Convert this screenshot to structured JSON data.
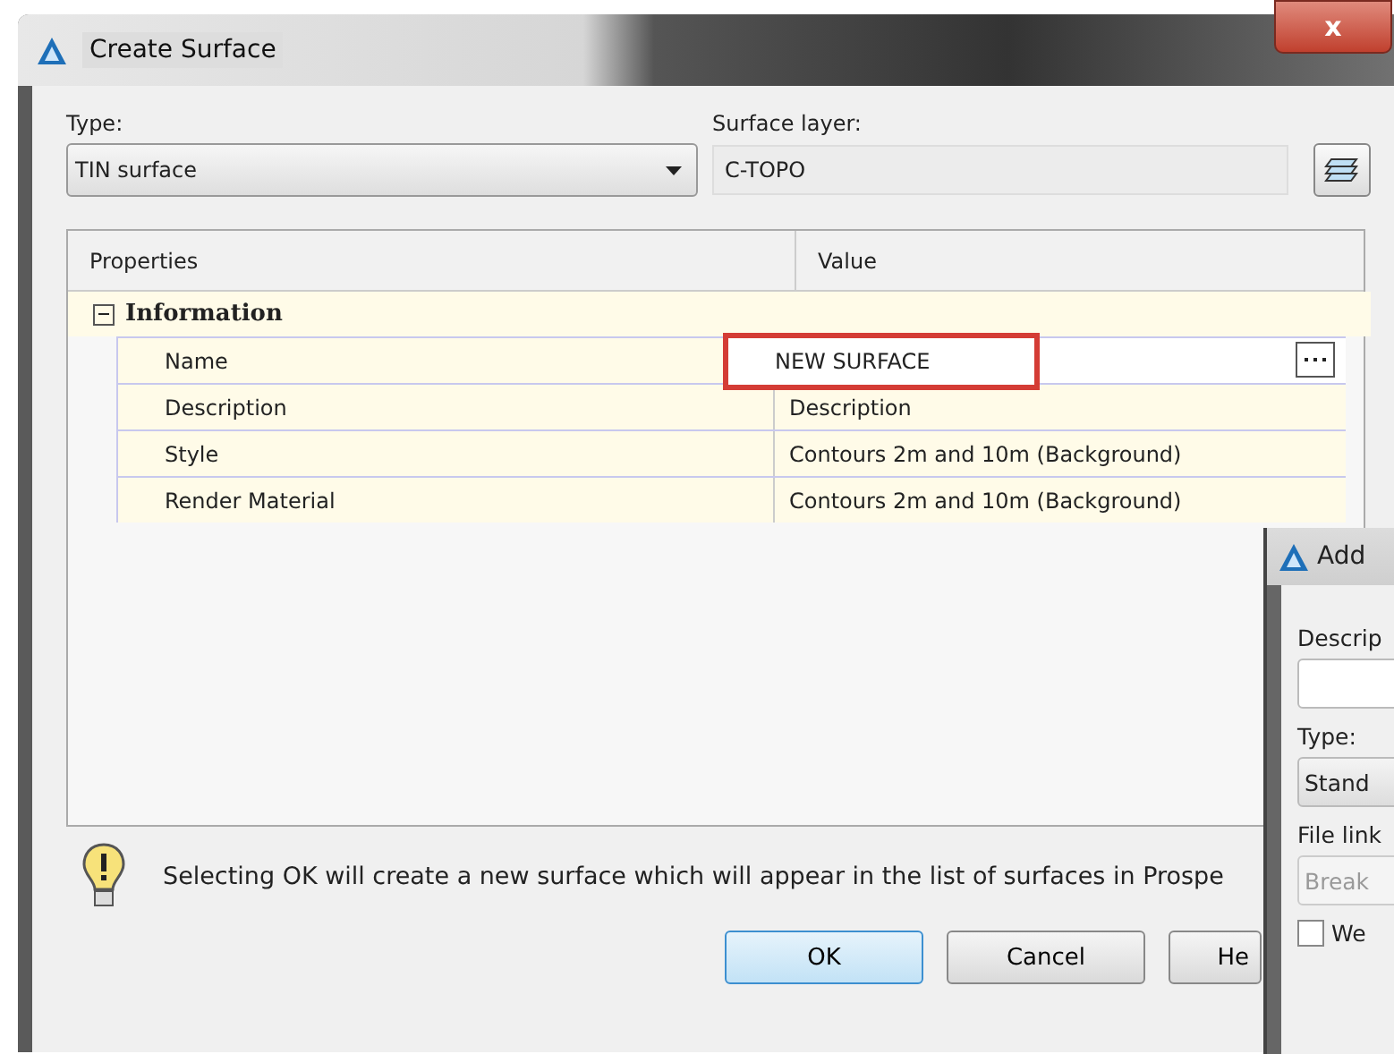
{
  "window": {
    "title": "Create Surface",
    "close": "x"
  },
  "type": {
    "label": "Type:",
    "value": "TIN surface"
  },
  "surface_layer": {
    "label": "Surface layer:",
    "value": "C-TOPO"
  },
  "grid": {
    "columns": [
      "Properties",
      "Value"
    ],
    "sections": [
      {
        "title": "Information",
        "expanded": true,
        "rows": [
          {
            "property": "Name",
            "value": "NEW SURFACE",
            "editing": true
          },
          {
            "property": "Description",
            "value": "Description",
            "editing": false
          },
          {
            "property": "Style",
            "value": "Contours 2m and 10m (Background)",
            "editing": false
          },
          {
            "property": "Render Material",
            "value": "Contours 2m and 10m (Background)",
            "editing": false
          }
        ]
      }
    ]
  },
  "message": "Selecting OK will create a new surface which will appear in the list of surfaces in Prospe",
  "buttons": [
    {
      "label": "OK",
      "default": true
    },
    {
      "label": "Cancel",
      "default": false
    },
    {
      "label": "He",
      "default": false
    }
  ],
  "second_window": {
    "title": "Add",
    "description_label": "Descrip",
    "type_label": "Type:",
    "type_value": "Stand",
    "file_link_label": "File link",
    "file_link_placeholder": "Break",
    "checkbox": {
      "label": "We",
      "checked": false
    }
  }
}
